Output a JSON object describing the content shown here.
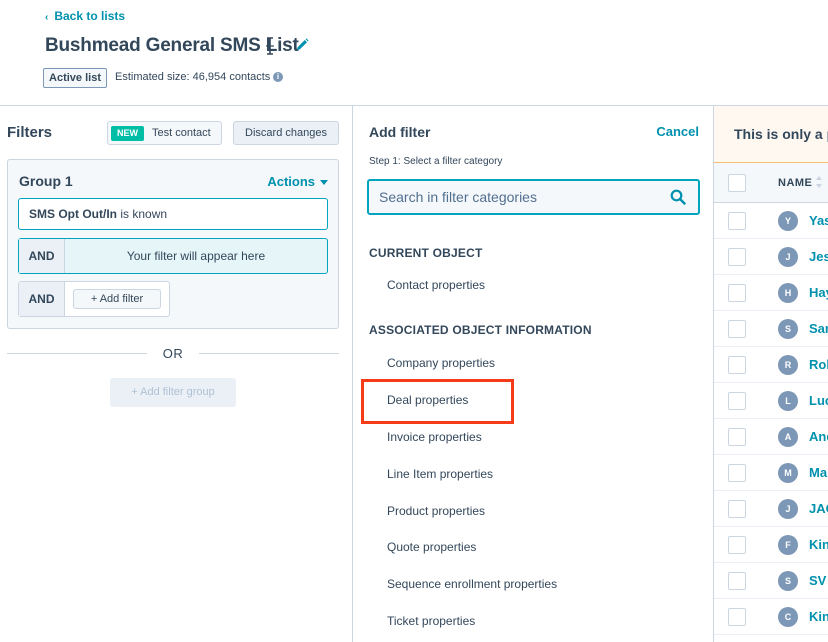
{
  "header": {
    "back_label": "Back to lists",
    "title": "Bushmead General SMS List",
    "status_badge": "Active list",
    "estimated_size": "Estimated size: 46,954 contacts"
  },
  "filters": {
    "title": "Filters",
    "new_tag": "NEW",
    "test_contact": "Test contact",
    "discard_changes": "Discard changes",
    "group_title": "Group 1",
    "actions_label": "Actions",
    "filter_property": "SMS Opt Out/In",
    "filter_condition": "is known",
    "and_label": "AND",
    "placeholder": "Your filter will appear here",
    "add_filter": "Add filter",
    "or_label": "OR",
    "add_filter_group": "Add filter group"
  },
  "add_filter": {
    "title": "Add filter",
    "cancel": "Cancel",
    "step_label": "Step 1: Select a filter category",
    "search_placeholder": "Search in filter categories",
    "current_object_heading": "CURRENT OBJECT",
    "current_object_items": [
      "Contact properties"
    ],
    "associated_heading": "ASSOCIATED OBJECT INFORMATION",
    "associated_items": [
      "Company properties",
      "Deal properties",
      "Invoice properties",
      "Line Item properties",
      "Product properties",
      "Quote properties",
      "Sequence enrollment properties",
      "Ticket properties"
    ]
  },
  "table": {
    "notice": "This is only a p",
    "name_header": "NAME",
    "rows": [
      {
        "initial": "Y",
        "name": "Yas"
      },
      {
        "initial": "J",
        "name": "Jes"
      },
      {
        "initial": "H",
        "name": "Hay"
      },
      {
        "initial": "S",
        "name": "Sar"
      },
      {
        "initial": "R",
        "name": "Rob"
      },
      {
        "initial": "L",
        "name": "Luc"
      },
      {
        "initial": "A",
        "name": "And"
      },
      {
        "initial": "M",
        "name": "Ma"
      },
      {
        "initial": "J",
        "name": "JAC"
      },
      {
        "initial": "F",
        "name": "Kin"
      },
      {
        "initial": "S",
        "name": "SV"
      },
      {
        "initial": "C",
        "name": "Kin"
      }
    ]
  },
  "colors": {
    "accent": "#0091ae",
    "highlight": "#f53b18",
    "new_tag": "#00bda5"
  }
}
